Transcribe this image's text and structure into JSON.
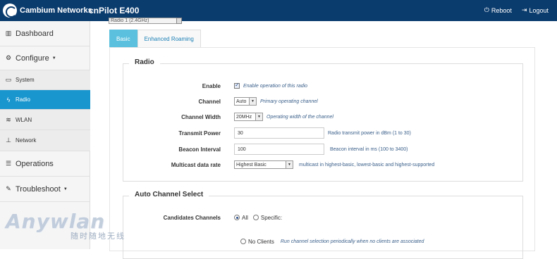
{
  "header": {
    "brand": "Cambium Networks",
    "product": "cnPilot E400",
    "reboot_label": "Reboot",
    "logout_label": "Logout"
  },
  "sidebar": {
    "items": [
      {
        "label": "Dashboard",
        "icon": "bar-chart-icon"
      },
      {
        "label": "Configure",
        "icon": "gear-icon"
      },
      {
        "label": "System",
        "icon": "monitor-icon"
      },
      {
        "label": "Radio",
        "icon": "lightning-icon"
      },
      {
        "label": "WLAN",
        "icon": "wifi-icon"
      },
      {
        "label": "Network",
        "icon": "sitemap-icon"
      },
      {
        "label": "Operations",
        "icon": "sliders-icon"
      },
      {
        "label": "Troubleshoot",
        "icon": "wrench-icon"
      }
    ],
    "active": "Radio"
  },
  "top_select": {
    "value": "Radio 1 (2.4GHz)"
  },
  "tabs": [
    {
      "label": "Basic",
      "active": true
    },
    {
      "label": "Enhanced Roaming",
      "active": false
    }
  ],
  "radio_section": {
    "title": "Radio",
    "enable": {
      "label": "Enable",
      "checked": true,
      "hint": "Enable operation of this radio"
    },
    "channel": {
      "label": "Channel",
      "value": "Auto",
      "hint": "Primary operating channel"
    },
    "channel_width": {
      "label": "Channel Width",
      "value": "20MHz",
      "hint": "Operating width of the channel"
    },
    "transmit_power": {
      "label": "Transmit Power",
      "value": "30",
      "hint": "Radio transmit power in dBm (1 to 30)"
    },
    "beacon_interval": {
      "label": "Beacon Interval",
      "value": "100",
      "hint": "Beacon interval in ms (100 to 3400)"
    },
    "multicast_rate": {
      "label": "Multicast data rate",
      "value": "Highest Basic",
      "hint": "multicast in highest-basic, lowest-basic and highest-supported"
    }
  },
  "acs_section": {
    "title": "Auto Channel Select",
    "candidates": {
      "label": "Candidates Channels",
      "option_all": "All",
      "option_specific": "Specific:",
      "selected": "All"
    },
    "no_clients": {
      "label": "No Clients",
      "hint": "Run channel selection periodically when no clients are associated"
    }
  },
  "watermark": {
    "main": "Anywlan",
    "sub": "随时随地无线"
  },
  "colors": {
    "navbar": "#0b3c6e",
    "active": "#1a96cf",
    "tab_active": "#5bc0de"
  }
}
